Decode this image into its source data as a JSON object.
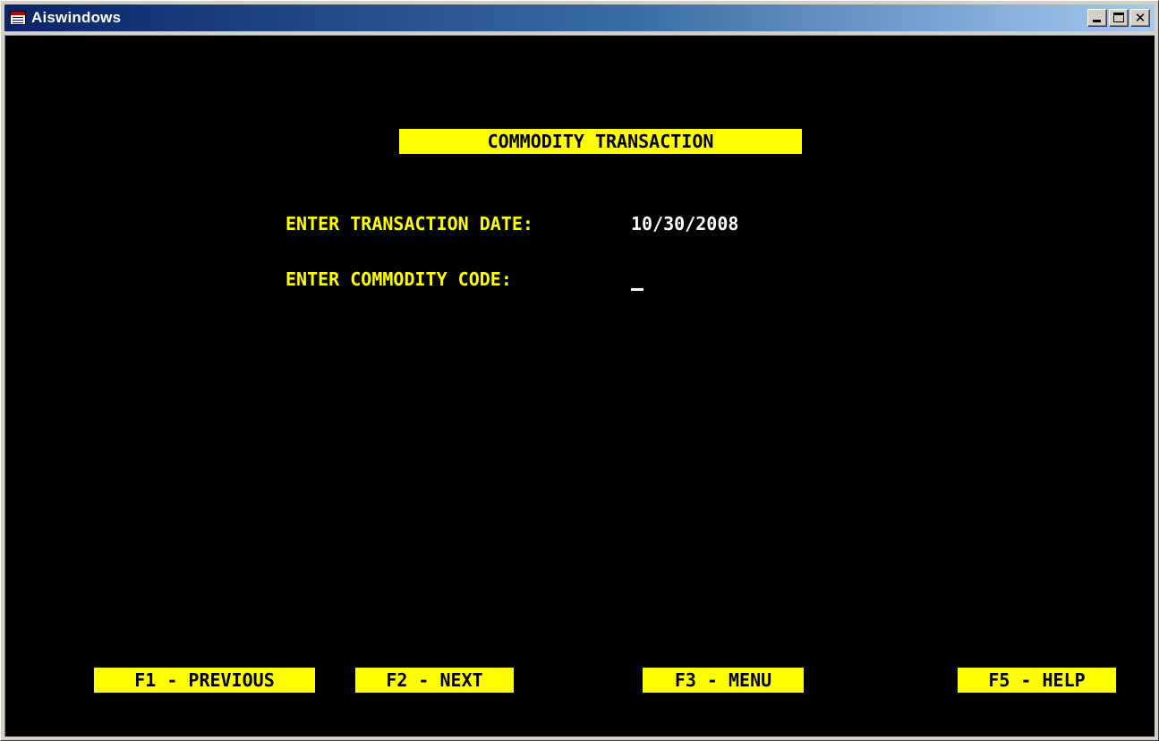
{
  "window": {
    "title": "Aiswindows",
    "icon": "window-app-icon",
    "controls": {
      "minimize": "minimize-icon",
      "maximize": "maximize-icon",
      "close": "close-icon",
      "close_glyph": "✕"
    }
  },
  "screen": {
    "title": "COMMODITY TRANSACTION",
    "fields": [
      {
        "label": "ENTER TRANSACTION DATE:",
        "value": "10/30/2008"
      },
      {
        "label": "ENTER COMMODITY CODE:",
        "value": ""
      }
    ],
    "function_keys": [
      {
        "label": "F1 - PREVIOUS"
      },
      {
        "label": "F2 - NEXT"
      },
      {
        "label": "F3 - MENU"
      },
      {
        "label": "F5 - HELP"
      }
    ]
  },
  "colors": {
    "background": "#000000",
    "label_text": "#ffff00",
    "value_text": "#ffffff",
    "highlight_bg": "#ffff00",
    "highlight_text": "#000000",
    "titlebar_start": "#0a246a",
    "titlebar_end": "#a6caf0"
  }
}
